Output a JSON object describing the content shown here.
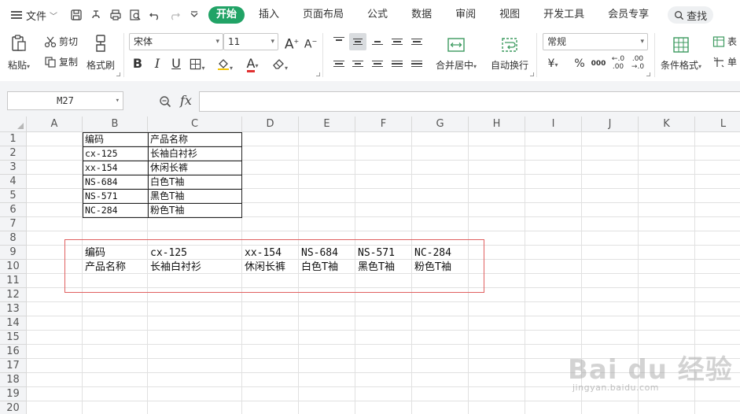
{
  "menubar": {
    "file_label": "文件",
    "tabs": [
      {
        "label": "开始",
        "active": true
      },
      {
        "label": "插入"
      },
      {
        "label": "页面布局"
      },
      {
        "label": "公式"
      },
      {
        "label": "数据"
      },
      {
        "label": "审阅"
      },
      {
        "label": "视图"
      },
      {
        "label": "开发工具"
      },
      {
        "label": "会员专享"
      }
    ],
    "search_label": "查找",
    "active_color": "#21a366"
  },
  "ribbon": {
    "paste_label": "粘贴",
    "cut_label": "剪切",
    "copy_label": "复制",
    "format_painter_label": "格式刷",
    "font_name": "宋体",
    "font_size": "11",
    "merge_label": "合并居中",
    "wrap_label": "自动换行",
    "number_format": "常规",
    "cond_format_label": "条件格式",
    "table_label": "表",
    "single_label": "单",
    "bold": "B",
    "italic": "I",
    "underline": "U",
    "percent": "%",
    "thousands": "000",
    "yen": "¥",
    "font_grow": "A",
    "font_shrink": "A",
    "font_color_letter": "A",
    "font_color": "#e03030"
  },
  "formula_bar": {
    "name_box": "M27",
    "fx": "fx",
    "formula": ""
  },
  "grid": {
    "columns": [
      "A",
      "B",
      "C",
      "D",
      "E",
      "F",
      "G",
      "H",
      "I",
      "J",
      "K",
      "L"
    ],
    "rows": [
      "1",
      "2",
      "3",
      "4",
      "5",
      "6",
      "7",
      "8",
      "9",
      "10",
      "11",
      "12",
      "13",
      "14",
      "15",
      "16",
      "17",
      "18",
      "19",
      "20"
    ],
    "source_table": [
      [
        "编码",
        "产品名称"
      ],
      [
        "cx-125",
        "长袖白衬衫"
      ],
      [
        "xx-154",
        "休闲长裤"
      ],
      [
        "NS-684",
        "白色T袖"
      ],
      [
        "NS-571",
        "黑色T袖"
      ],
      [
        "NC-284",
        "粉色T袖"
      ]
    ],
    "transposed": {
      "row9": [
        "编码",
        "cx-125",
        "xx-154",
        "NS-684",
        "NS-571",
        "NC-284"
      ],
      "row10": [
        "产品名称",
        "长袖白衬衫",
        "休闲长裤",
        "白色T袖",
        "黑色T袖",
        "粉色T袖"
      ]
    },
    "highlight_color": "#e06060"
  },
  "watermark": {
    "text": "Bai du 经验",
    "sub": "jingyan.baidu.com"
  }
}
